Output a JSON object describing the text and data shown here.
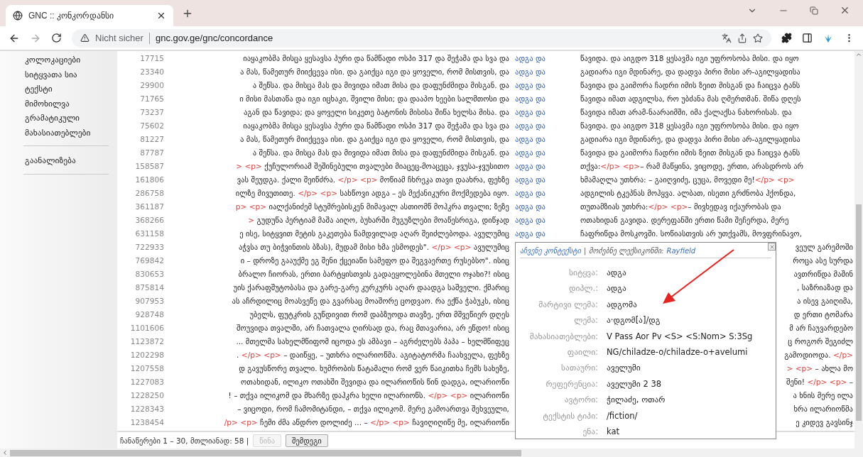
{
  "browser": {
    "tab": {
      "title": "GNC :: კონკორდანსი"
    },
    "address": {
      "security": "Nicht sicher",
      "url": "gnc.gov.ge/gnc/concordance"
    }
  },
  "sidebar": {
    "sections": [
      {
        "items": [
          "კოლოკაციები",
          "სიტყვათა სია",
          "ტექსტი",
          "მიმოხილვა",
          "გრამატიკული მახასიათებლები"
        ]
      },
      {
        "items": [
          "გაანალიზება"
        ]
      }
    ]
  },
  "concordance": {
    "rows": [
      {
        "kind": "full",
        "number": "17715",
        "left": [
          "იაყაკობმა მისცა ყესავსა პური და წამწადი ოსპი 317 და შეჭამა და სვა და"
        ],
        "keyword": "ადგა და",
        "right": [
          "წავიდა. და აიგდო 318 ყესავმა იგი უფროსობა მისი. და იყო"
        ]
      },
      {
        "kind": "full",
        "number": "23340",
        "left": [
          "ა მას, წამეთურ მიიქცევა ისი. და გაიქცა იგი და ყოველი, რომ მისთვის, და"
        ],
        "keyword": "ადგა და",
        "right": [
          "გადიარა იგი მდინარე, და დადვა პირი მისი არ-აგილყადისა"
        ]
      },
      {
        "kind": "full",
        "number": "29900",
        "left": [
          "ა შეწსა. და მისცა მას და მივიდა იმათ მისა და დაფუნძმიდა მისგან. და"
        ],
        "keyword": "ადგა და",
        "right": [
          "წავიდა და გაიმორა ჩადრი იმის ზეით მისგან და ჩაიცვა ტანს"
        ]
      },
      {
        "kind": "full",
        "number": "71765",
        "left": [
          "ი მისი მასთაწა და იგი იცხაკი, შვილი მისი; და დააპო ხეები სალმთოსი და"
        ],
        "keyword": "ადგა და",
        "right": [
          "წავიდა იმათ ადგილსა, რო უბძანა მას ღმერთმან. შიწა დღეს"
        ]
      },
      {
        "kind": "full",
        "number": "73237",
        "left": [
          "აგან და წავიდა; და ყოველი სიკეთე ბატონის მისისა შიწა ხელსა მისა. და"
        ],
        "keyword": "ადგა და",
        "right": [
          "წავიდა იმათ არამ-ნაარაიმში, იმა ქალაქსა ნახორისას. და"
        ]
      },
      {
        "kind": "full",
        "number": "75602",
        "left": [
          "იაყაკობმა მისცა ყესავსა პური და წამწადი ოსპი 317 და შეჭამა და სვა და"
        ],
        "keyword": "ადგა და",
        "right": [
          "წავიდა. და აიგდო 318 ყესავმა იგი უფროსობა მისი. და იყო"
        ]
      },
      {
        "kind": "full",
        "number": "81227",
        "left": [
          "ა მას, წამეთურ მიიქცევა ისი. და გაიქცა იგი და ყოველი, რომ მისთვის, და"
        ],
        "keyword": "ადგა და",
        "right": [
          "გადიარა იგი მდინარე, და დადვა პირი მისი არ-აგილყადისა"
        ]
      },
      {
        "kind": "full",
        "number": "87787",
        "left": [
          "ა შეწსა. და მისცა მას და მივიდა იმათ მისა და დაფუნძმიდა მისგან. და"
        ],
        "keyword": "ადგა და",
        "right": [
          "წავიდა და გაიმორა ჩადრი იმის ზეით მისგან და ჩაიცვა ტანს"
        ]
      },
      {
        "kind": "full",
        "number": "158587",
        "left": [
          {
            "kind": "markup",
            "text": "> <p>"
          },
          " ქუჩულორიამ შეშინებული თვალები მიაცეც-მოაცეცა, ჯვუსა-ჯვუსითო"
        ],
        "keyword": "ადგა და",
        "right": [
          "თქვა: ",
          {
            "kind": "markup",
            "text": "</p> <p>"
          },
          " – რამ მაწყინა, ვიცოდე, ერთი, არასდროს არ"
        ]
      },
      {
        "kind": "full",
        "number": "161806",
        "left": [
          "ვას შეუდგა. ქალი შეიწძრა. ",
          {
            "kind": "markup",
            "text": "</p> <p>"
          },
          " მოწიამ ჩხრეკა თავი დაახრა, ფეხზე"
        ],
        "keyword": "ადგა და",
        "right": [
          "ხმამაღლა უთხრა: – გაიღვიძე, ცუცა, მოვედი მე! ",
          {
            "kind": "markup",
            "text": "</p> <p>"
          }
        ]
      },
      {
        "kind": "full",
        "number": "286758",
        "left": [
          "ილზე მივუთითე. ",
          {
            "kind": "markup",
            "text": "</p> <p>"
          },
          " სახწოვი ადგა – ეს მექანიკური მოქმედება იყო."
        ],
        "keyword": "ადგა და",
        "right": [
          "ადგილის ტკეპნას მოჰყვა. ალბათ, ისეთი გრძნობა ჰქონდა,"
        ]
      },
      {
        "kind": "full",
        "number": "361187",
        "left": [
          {
            "kind": "markup",
            "text": "p> <p>"
          },
          " იალქანიძემ სტუმრებისკენ მიმავალ ასთიომწ მოჰკრა თვალი; ზეზე"
        ],
        "keyword": "ადგა და",
        "right": [
          "თუთამზიას უთხრა: ",
          {
            "kind": "markup",
            "text": "</p> <p>"
          },
          " – მივხედავ იქაურობას და"
        ]
      },
      {
        "kind": "full",
        "number": "368266",
        "left": [
          {
            "kind": "markup",
            "text": ">"
          },
          " გუდუწა პერტიამ მაშა აიღო, ბუხარში მუგუზლები მოაწესრიგა, დიწჯად"
        ],
        "keyword": "ადგა და",
        "right": [
          "ოთახიდან გავიდა. დერეფანში ერთი წამი შეჩერდა, მერე"
        ]
      },
      {
        "kind": "full",
        "number": "631158",
        "left": [
          "ე ისე, სიტყვით მეტის გაკეთება წამდვილად აღარ შეიძლებოდა. ავულუმიც"
        ],
        "keyword": "ადგა და",
        "right": [
          "ჩაფრიწდა მოსკოვში. სოწიასთვის არ უთქვამს, მოვფრინავო,"
        ]
      },
      {
        "kind": "covered",
        "number": "722933",
        "left": [
          "აჭვსა თუ ბიჭვინთის ბზას), მუდამ მისი ხმა ესმოდეს\". ",
          {
            "kind": "markup",
            "text": "</p> <p>"
          },
          " ავულუმიც"
        ],
        "right": [
          "ვეულ გარემოში"
        ]
      },
      {
        "kind": "covered",
        "number": "769842",
        "left": [
          "ი – დროზე გააუქმე ეგ შენი ქცეიაწი სამეფო და შეგვაერთე რუსებსო\". ისიც"
        ],
        "right": [
          "როცა ასე სურდა"
        ]
      },
      {
        "kind": "covered",
        "number": "830653",
        "left": [
          "ბრალო ჩიორას, ერთი ბარტყისთვის გადაეყოლებინა მთელი ოჯახი?! ისიც"
        ],
        "right": [
          "ავთრიწდა მაშინ"
        ]
      },
      {
        "kind": "covered",
        "number": "875814",
        "left": [
          "უის ქარაფშუტობასა და გარე-გარე კურკურს აღარ დაადგა საშველი. ქმარიც"
        ],
        "right": [
          ", საზრიაზად და"
        ]
      },
      {
        "kind": "covered",
        "number": "907953",
        "left": [
          "ას აჩრდილიც მოასვეწე და გვარსაც მოაშორე ცოდვაო. რა ექწა ჭაბუკს, ისიც"
        ],
        "right": [
          "ა ისევ გაიღიმა,"
        ]
      },
      {
        "kind": "covered",
        "number": "928748",
        "left": [
          "უბელს, ფუტკრის გუწდივით რომ დაბზუოდა თავზე, ერთ მშვეწიერ დღეს"
        ],
        "right": [
          "დ ერთი ტომარა"
        ]
      },
      {
        "kind": "covered",
        "number": "1101606",
        "left": [
          "შოუვიდა თვალში, არ ჩათვალა ღირსად და, რაც მთავარია, არ ეწდო! ისიც"
        ],
        "right": [
          "მ არ ჩაუვარდებო"
        ]
      },
      {
        "kind": "covered",
        "number": "1123872",
        "left": [
          "... მთელმა სახელმწიფომ იცოდა ეს ამბავი – აგრძელებს პაპა – ხელმწიფეც"
        ],
        "right": [
          "ც როგორ შეგიძლ"
        ]
      },
      {
        "kind": "covered",
        "number": "1202298",
        "left": [
          ". ",
          {
            "kind": "markup",
            "text": "</p> <p>"
          },
          " – დაიწყე, – უთხრა ილარიოწმა. აგიტატორმა ჩაახველა, ფეხზე"
        ],
        "right": [
          "გამოდიოდა. ",
          {
            "kind": "markup",
            "text": "</p>"
          }
        ]
      },
      {
        "kind": "covered",
        "number": "1207558",
        "left": [
          "დ გავუსწორე თვალი. ხუმრობის წატამალი რომ ვერ წაიკითხა ჩემს სახეზე,"
        ],
        "right": [
          {
            "kind": "markup",
            "text": "> <p>"
          },
          " – ახლა მო"
        ]
      },
      {
        "kind": "covered",
        "number": "1227083",
        "left": [
          "ოთახიდან, ილიკო ოთახში შევიდა და ილარიოწის წინ დადგა, ილარიოწი"
        ],
        "right": [
          "შენი! ",
          {
            "kind": "markup",
            "text": "</p> <p>"
          },
          " –"
        ]
      },
      {
        "kind": "covered",
        "number": "1228250",
        "left": [
          "! – თქვა ილიკომ და მხარზე დაჰკრა ხელი ილარიოწს. ",
          {
            "kind": "markup",
            "text": "</p> <p>"
          },
          " ილარიოწი"
        ],
        "right": [
          "ა ხნის მერე ილა"
        ]
      },
      {
        "kind": "covered",
        "number": "1228343",
        "left": [
          "– ვიცოდი, რომ ჩამომიტანდი, – თქვა ილიკომ. მერე გამოართვა შეხვეული,"
        ],
        "right": [
          "ხრა ილარიოწმა"
        ]
      },
      {
        "kind": "covered",
        "number": "1238454",
        "left": [
          {
            "kind": "markup",
            "text": "/p> <p>"
          },
          " ჩემი ძმა აწდრო დოლიძე ... – ",
          {
            "kind": "markup",
            "text": "</p> <p>"
          },
          " ჩავიღიღიწე მე, ილარიოწი"
        ],
        "right": [
          "ე კიდევ გავსინჯ"
        ]
      }
    ]
  },
  "pager": {
    "summary": "ჩანაწერები 1 – 30, მთლიანად: 58 |",
    "buttons": [
      {
        "label": "წინა",
        "disabled": true
      },
      {
        "label": "შემდეგი",
        "disabled": false
      }
    ]
  },
  "popup": {
    "context_link": "აჩვენე კონტექსტი",
    "separator": "|",
    "dictionary_label": "მოძებნე ლექსიკონში:",
    "dictionary_link": "Rayfield",
    "fields": [
      {
        "label": "სიტყვა:",
        "value": "ადგა"
      },
      {
        "label": "დიპლ.:",
        "value": "ადგა"
      },
      {
        "label": "მარტივი ლემა:",
        "value": "ადგომა"
      },
      {
        "label": "ლემა:",
        "value": "ა·დგომ[ა]/დგ"
      },
      {
        "label": "მახასიათებლები:",
        "value": "V Pass Aor Pv <S> <S:Nom> S:3Sg"
      },
      {
        "label": "ფაილი:",
        "value": "NG/chiladze-o/chiladze-o+avelumi"
      },
      {
        "label": "სათაური:",
        "value": "აველუმი"
      },
      {
        "label": "რეფერენცია:",
        "value": "აველუმი 2 38"
      },
      {
        "label": "ავტორი:",
        "value": "ჭილაძე, ოთარ"
      },
      {
        "label": "ტექსტის ტიპი:",
        "value": "/fiction/"
      },
      {
        "label": "ენა:",
        "value": "kat"
      }
    ]
  }
}
